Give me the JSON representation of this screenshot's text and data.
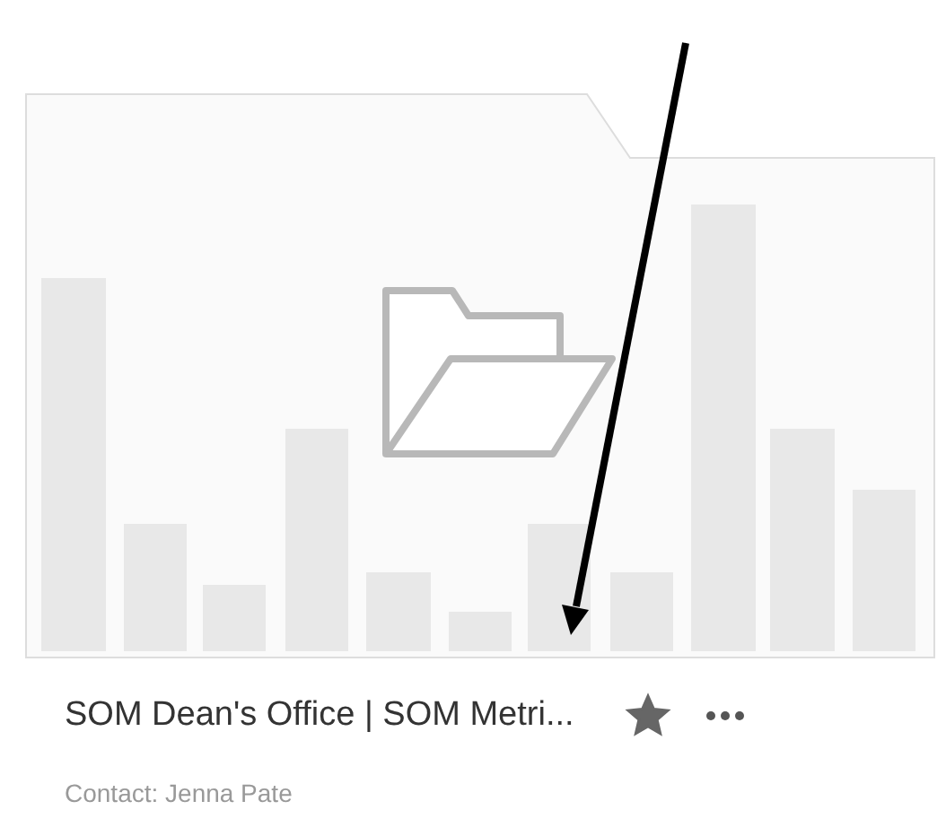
{
  "card": {
    "title": "SOM Dean's Office | SOM Metri...",
    "favorite": true,
    "contact": "Contact: Jenna Pate"
  }
}
